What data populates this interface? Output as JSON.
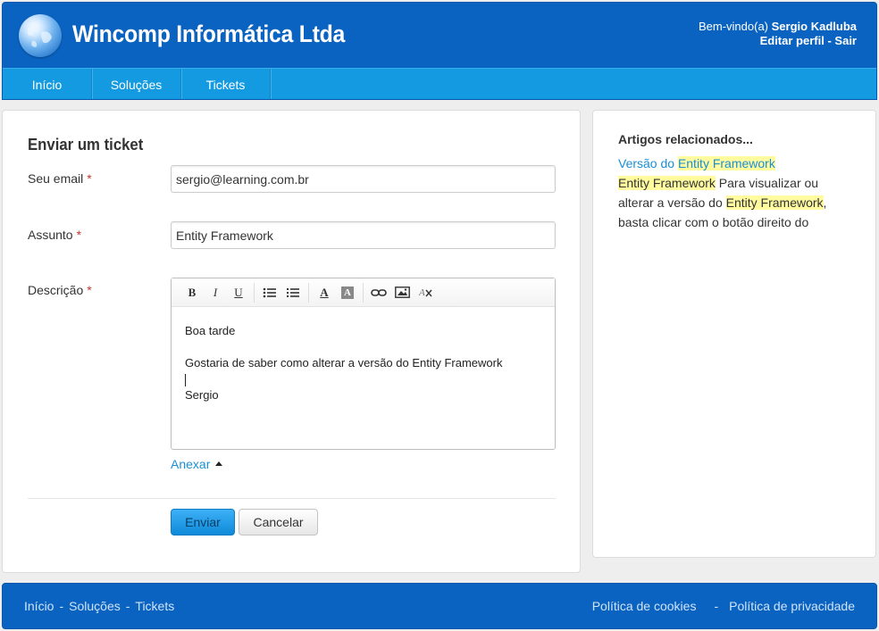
{
  "header": {
    "title": "Wincomp Informática Ltda",
    "welcome_prefix": "Bem-vindo(a)",
    "user_name": "Sergio Kadluba",
    "edit_profile": "Editar perfil",
    "link_separator": "-",
    "logout": "Sair"
  },
  "nav": {
    "items": [
      "Início",
      "Soluções",
      "Tickets"
    ]
  },
  "form": {
    "title": "Enviar um ticket",
    "required_mark": "*",
    "email_label": "Seu email",
    "email_value": "sergio@learning.com.br",
    "subject_label": "Assunto",
    "subject_value": "Entity Framework",
    "description_label": "Descrição",
    "description_lines": [
      "Boa tarde",
      "Gostaria de saber como alterar a versão do Entity Framework",
      "Sergio"
    ],
    "toolbar_glyphs": {
      "bold": "B",
      "italic": "I",
      "underline": "U",
      "font_color": "A",
      "bg_color": "A"
    },
    "attach_label": "Anexar",
    "submit_label": "Enviar",
    "cancel_label": "Cancelar"
  },
  "side": {
    "title": "Artigos relacionados...",
    "article_link_prefix": "Versão do ",
    "article_link_highlight": "Entity Framework",
    "article_snippet_highlight": "Entity Framework",
    "article_snippet_mid": " Para visualizar ou alterar a versão do ",
    "article_snippet_highlight2": "Entity Framework",
    "article_snippet_end": ", basta clicar com o botão direito do"
  },
  "footer": {
    "left_links": [
      "Início",
      "Soluções",
      "Tickets"
    ],
    "separator": "-",
    "right_links": [
      "Política de cookies",
      "Política de privacidade"
    ]
  },
  "colors": {
    "header_bg": "#0b63c1",
    "nav_bg": "#139ae0",
    "link": "#1a8fd6",
    "highlight": "#fffb9e",
    "required": "#c0392b"
  }
}
